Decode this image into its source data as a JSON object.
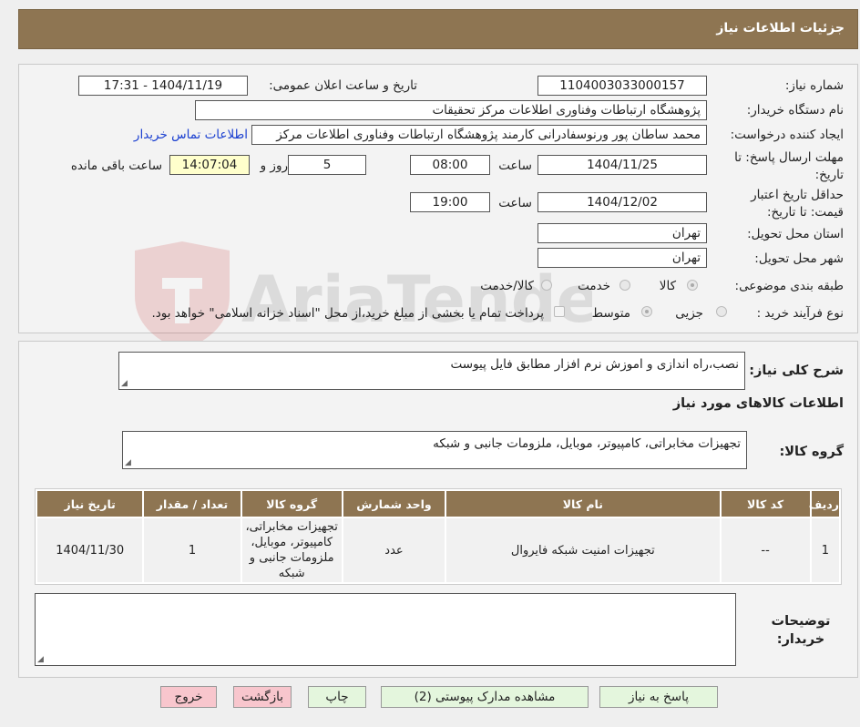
{
  "header": {
    "title": "جزئیات اطلاعات نیاز"
  },
  "watermark": {
    "text": "AriaTender.neT"
  },
  "form": {
    "need_number_label": "شماره نیاز:",
    "need_number": "1104003033000157",
    "announce_label": "تاریخ و ساعت اعلان عمومی:",
    "announce_value": "1404/11/19 - 17:31",
    "buyer_org_label": "نام دستگاه خریدار:",
    "buyer_org": "پژوهشگاه ارتباطات وفناوری اطلاعات مرکز تحقیقات",
    "creator_label": "ایجاد کننده درخواست:",
    "creator": "محمد ساطان پور ورنوسفادرانی کارمند پژوهشگاه ارتباطات وفناوری اطلاعات مرکز",
    "contact_link": "اطلاعات تماس خریدار",
    "deadline_label": "مهلت ارسال پاسخ: تا تاریخ:",
    "deadline_date": "1404/11/25",
    "time_label": "ساعت",
    "deadline_time": "08:00",
    "days_value": "5",
    "days_label": "روز و",
    "remaining_value": "14:07:04",
    "remaining_label": "ساعت باقی مانده",
    "validity_label": "حداقل تاریخ اعتبار قیمت: تا تاریخ:",
    "validity_date": "1404/12/02",
    "validity_time": "19:00",
    "province_label": "استان محل تحویل:",
    "province": "تهران",
    "city_label": "شهر محل تحویل:",
    "city": "تهران",
    "category_label": "طبقه بندی موضوعی:",
    "category_options": [
      "کالا",
      "خدمت",
      "کالا/خدمت"
    ],
    "category_selected": "کالا",
    "process_label": "نوع فرآیند خرید :",
    "process_options": [
      "جزیی",
      "متوسط"
    ],
    "process_selected": "متوسط",
    "payment_note": "پرداخت تمام یا بخشی از مبلغ خرید،از محل \"اسناد خزانه اسلامی\" خواهد بود."
  },
  "description": {
    "label": "شرح کلی نیاز:",
    "value": "نصب،راه اندازی و اموزش نرم افزار مطابق فایل پیوست"
  },
  "goods": {
    "section_title": "اطلاعات کالاهای مورد نیاز",
    "group_label": "گروه کالا:",
    "group_value": "تجهیزات مخابراتی، کامپیوتر، موبایل، ملزومات جانبی و شبکه",
    "columns": [
      "ردیف",
      "کد کالا",
      "نام کالا",
      "واحد شمارش",
      "گروه کالا",
      "تعداد / مقدار",
      "تاریخ نیاز"
    ],
    "rows": [
      [
        "1",
        "--",
        "تجهیزات امنیت شبکه فایروال",
        "عدد",
        "تجهیزات مخابراتی، کامپیوتر، موبایل، ملزومات جانبی و شبکه",
        "1",
        "1404/11/30"
      ]
    ]
  },
  "buyer_notes": {
    "label": "توضیحات خریدار:",
    "value": ""
  },
  "actions": {
    "respond": "پاسخ به نیاز",
    "attachments": "مشاهده مدارک پیوستی (2)",
    "print": "چاپ",
    "back": "بازگشت",
    "exit": "خروج"
  },
  "colors": {
    "header_bg": "#8e7552",
    "button_green": "#e4f6dd",
    "button_red": "#f8c6cd",
    "link": "#1a3fd0"
  }
}
